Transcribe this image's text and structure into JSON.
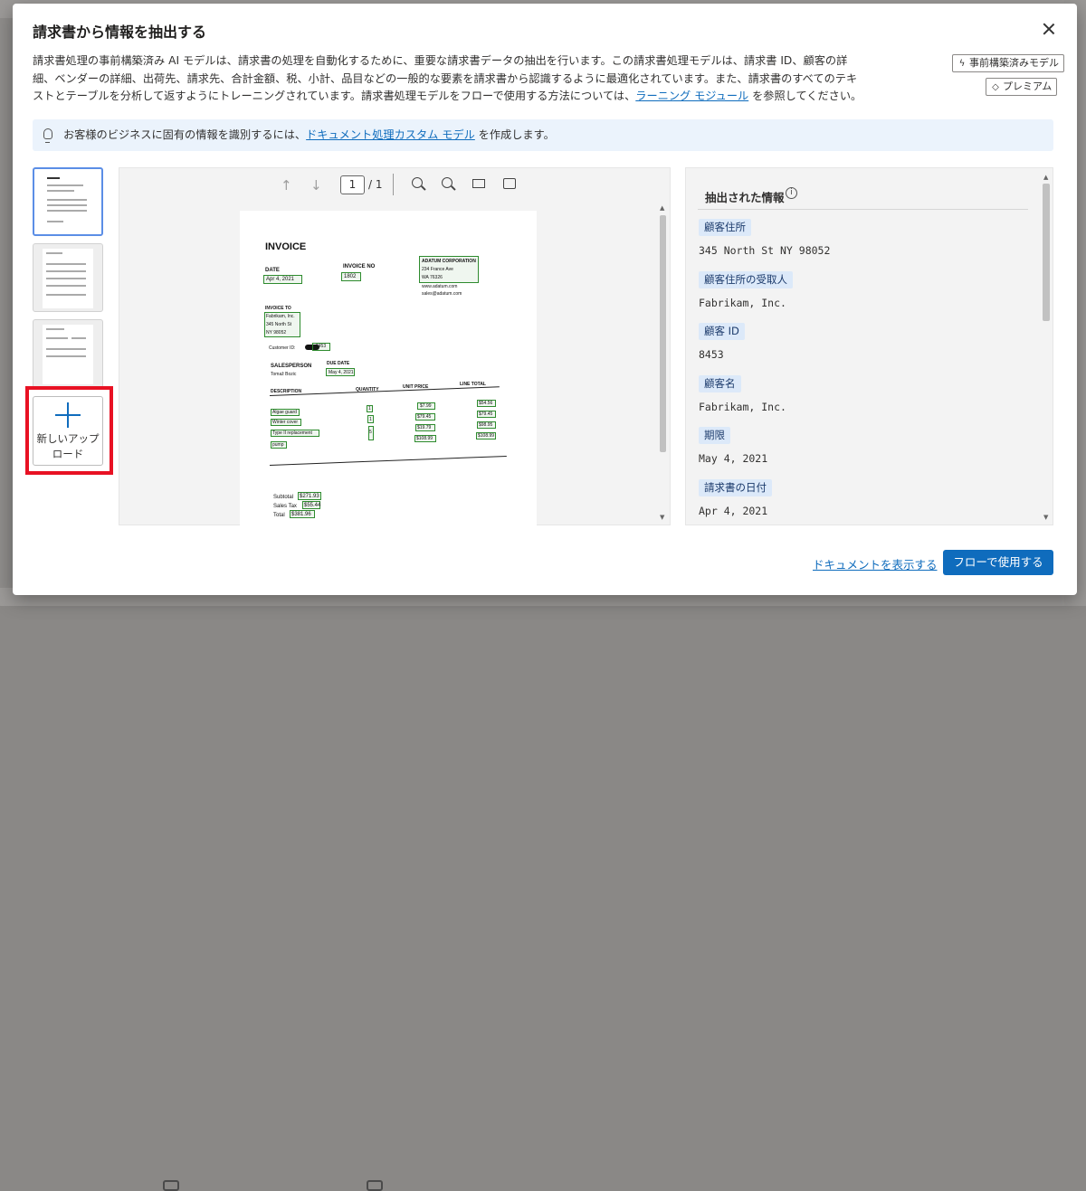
{
  "dialog": {
    "title": "請求書から情報を抽出する",
    "description_part1": "請求書処理の事前構築済み AI モデルは、請求書の処理を自動化するために、重要な請求書データの抽出を行います。この請求書処理モデルは、請求書 ID、顧客の詳細、ベンダーの詳細、出荷先、請求先、合計金額、税、小計、品目などの一般的な要素を請求書から認識するように最適化されています。また、請求書のすべてのテキストとテーブルを分析して返すようにトレーニングされています。請求書処理モデルをフローで使用する方法については、",
    "description_link": "ラーニング モジュール",
    "description_part2": " を参照してください。",
    "badge_prebuilt": "事前構築済みモデル",
    "badge_premium": "プレミアム",
    "info_part1": "お客様のビジネスに固有の情報を識別するには、",
    "info_link": "ドキュメント処理カスタム モデル",
    "info_part2": " を作成します。",
    "upload_label": "新しいアップロード"
  },
  "viewer": {
    "page_current": "1",
    "page_total": "/ 1"
  },
  "document": {
    "title": "INVOICE",
    "date_label": "DATE",
    "date_value": "Apr 4, 2021",
    "invoice_no_label": "INVOICE NO",
    "invoice_no_value": "1802",
    "vendor_name": "ADATUM CORPORATION",
    "vendor_addr1": "234 France Ave",
    "vendor_addr2": "WA 76326",
    "vendor_web": "www.adatum.com",
    "vendor_email": "sales@adatum.com",
    "invoice_to_label": "INVOICE TO",
    "customer_name": "Fabrikam, Inc.",
    "customer_addr1": "345 North St",
    "customer_addr2": "NY 98052",
    "customer_id_label": "Customer ID:",
    "customer_id_value": "8453",
    "salesperson_label": "SALESPERSON",
    "salesperson_value": "Tomaž Bozic",
    "due_date_label": "DUE DATE",
    "due_date_value": "May 4, 2021",
    "col_description": "DESCRIPTION",
    "col_quantity": "QUANTITY",
    "col_unit_price": "UNIT PRICE",
    "col_line_total": "LINE TOTAL",
    "items": [
      {
        "desc": "Algae guard",
        "qty": "1",
        "price": "$7.99",
        "total": "$54.56"
      },
      {
        "desc": "Winter cover",
        "qty": "1",
        "price": "$79.45",
        "total": "$79.45"
      },
      {
        "desc": "Type II replacement",
        "qty": "5",
        "price": "$19.79",
        "total": "$98.95"
      },
      {
        "desc": "pump",
        "qty": "1",
        "price": "$108.99",
        "total": "$108.99"
      }
    ],
    "subtotal_label": "Subtotal",
    "subtotal_value": "$271.93",
    "tax_label": "Sales Tax",
    "tax_value": "$55.44",
    "total_label": "Total",
    "total_value": "$381.96"
  },
  "extracted": {
    "heading": "抽出された情報",
    "fields": [
      {
        "label": "顧客住所",
        "value": "345 North St NY 98052"
      },
      {
        "label": "顧客住所の受取人",
        "value": "Fabrikam, Inc."
      },
      {
        "label": "顧客 ID",
        "value": "8453"
      },
      {
        "label": "顧客名",
        "value": "Fabrikam, Inc."
      },
      {
        "label": "期限",
        "value": "May 4, 2021"
      },
      {
        "label": "請求書の日付",
        "value": "Apr 4, 2021"
      }
    ]
  },
  "footer": {
    "view_document": "ドキュメントを表示する",
    "use_in_flow": "フローで使用する"
  },
  "colors": {
    "accent": "#0f6cbd",
    "highlight_red": "#e81123",
    "bbox_green": "#2e8b2e",
    "field_tag_bg": "#dce9f9"
  },
  "icons": [
    "close-icon",
    "lightning-icon",
    "diamond-icon",
    "lightbulb-icon",
    "arrow-up-icon",
    "arrow-down-icon",
    "zoom-out-icon",
    "zoom-in-icon",
    "fit-width-icon",
    "fit-page-icon",
    "info-icon",
    "plus-icon"
  ]
}
